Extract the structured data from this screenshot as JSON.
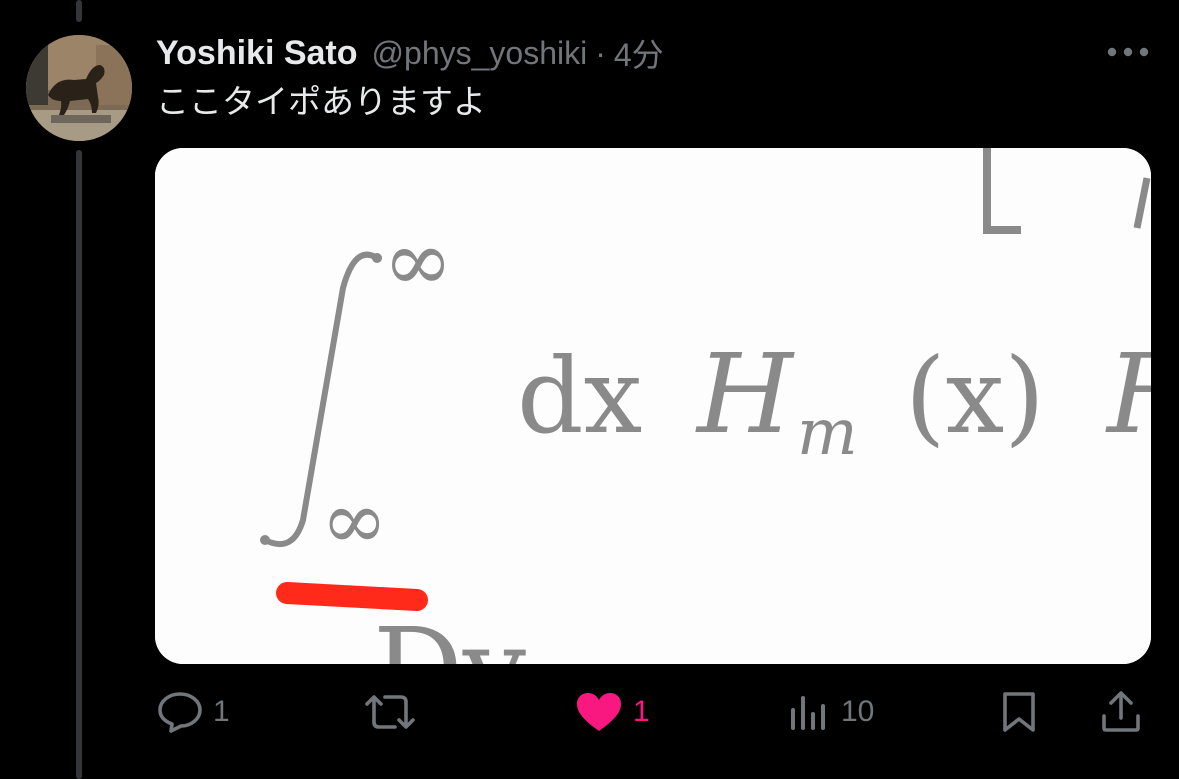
{
  "tweet": {
    "display_name": "Yoshiki Sato",
    "handle": "@phys_yoshiki",
    "separator": "·",
    "time": "4分",
    "text": "ここタイポありますよ"
  },
  "icons": {
    "avatar": "dog-statue-avatar",
    "more": "more-dots-icon",
    "reply": "reply-bubble-icon",
    "retweet": "retweet-icon",
    "like": "heart-icon",
    "views": "views-bar-chart-icon",
    "bookmark": "bookmark-icon",
    "share": "share-upload-icon"
  },
  "actions": {
    "reply_count": "1",
    "retweet_count": "",
    "like_count": "1",
    "views_count": "10"
  },
  "media": {
    "description_alt": "",
    "formula_text": {
      "infinity_top": "∞",
      "infinity_bottom": "∞",
      "dx": "dx",
      "H": "H",
      "subscript": "m",
      "paren_x": "(x)",
      "trailing": "H",
      "below": "Dv"
    }
  },
  "colors": {
    "background": "#000000",
    "text_primary": "#e7e9ea",
    "text_secondary": "#71767b",
    "like_pink": "#f91880",
    "thread_line": "#333639",
    "highlight_red": "#ff2a1a"
  }
}
